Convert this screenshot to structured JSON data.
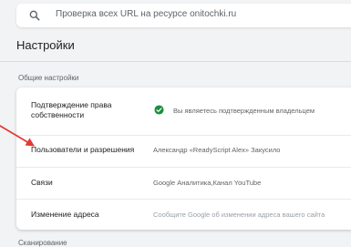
{
  "search": {
    "placeholder": "Проверка всех URL на ресурсе onitochki.ru"
  },
  "page_title": "Настройки",
  "sections": {
    "general_label": "Общие настройки",
    "crawling_label": "Сканирование"
  },
  "settings": {
    "ownership": {
      "label": "Подтверждение права собственности",
      "value": "Вы являетесь подтвержденным владельцем"
    },
    "users": {
      "label": "Пользователи и разрешения",
      "value": "Александр «ReadyScript Alex» Закусило"
    },
    "associations": {
      "label": "Связи",
      "value": "Google Аналитика,Канал YouTube"
    },
    "address_change": {
      "label": "Изменение адреса",
      "value": "Сообщите Google об изменении адреса вашего сайта"
    }
  },
  "colors": {
    "accent_check": "#1e8e3e",
    "annotation_arrow": "#e53935"
  },
  "icons": {
    "search": "search-icon",
    "check": "check-circle-icon",
    "annotation": "red-arrow"
  }
}
